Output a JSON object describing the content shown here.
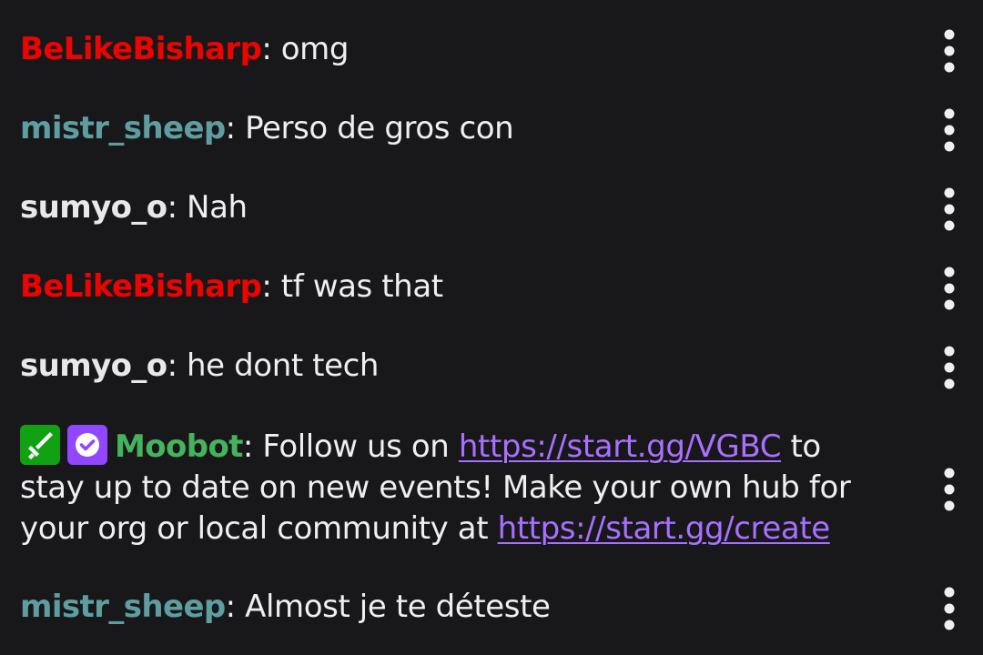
{
  "colors": {
    "background": "#18181b",
    "text": "#efeff1",
    "link": "#a970ff",
    "user_red": "#eb0400",
    "user_teal": "#5f9ea0",
    "user_white": "#e8e8e8",
    "user_green": "#45b35c",
    "badge_green": "#12a112",
    "badge_purple": "#9146ff"
  },
  "icons": {
    "more": "vertical-ellipsis-icon",
    "moderator_badge": "sword-icon",
    "verified_badge": "verified-check-icon"
  },
  "messages": [
    {
      "user": "BeLikeBisharp",
      "user_color": "#eb0400",
      "sep": ": ",
      "text": "omg"
    },
    {
      "user": "mistr_sheep",
      "user_color": "#5f9ea0",
      "sep": ": ",
      "text": "Perso de gros con"
    },
    {
      "user": "sumyo_o",
      "user_color": "#e8e8e8",
      "sep": ": ",
      "text": "Nah"
    },
    {
      "user": "BeLikeBisharp",
      "user_color": "#eb0400",
      "sep": ": ",
      "text": "tf was that"
    },
    {
      "user": "sumyo_o",
      "user_color": "#e8e8e8",
      "sep": ": ",
      "text": "he dont tech"
    },
    {
      "user": "Moobot",
      "user_color": "#45b35c",
      "badges": [
        "moderator",
        "verified"
      ],
      "sep": ": ",
      "parts": [
        {
          "text": "Follow us on "
        },
        {
          "link": "https://start.gg/VGBC"
        },
        {
          "text": " to stay up to date on new events! Make your own hub for your org or local community at "
        },
        {
          "link": "https://start.gg/create"
        }
      ]
    },
    {
      "user": "mistr_sheep",
      "user_color": "#5f9ea0",
      "sep": ": ",
      "text": "Almost je te déteste"
    }
  ]
}
